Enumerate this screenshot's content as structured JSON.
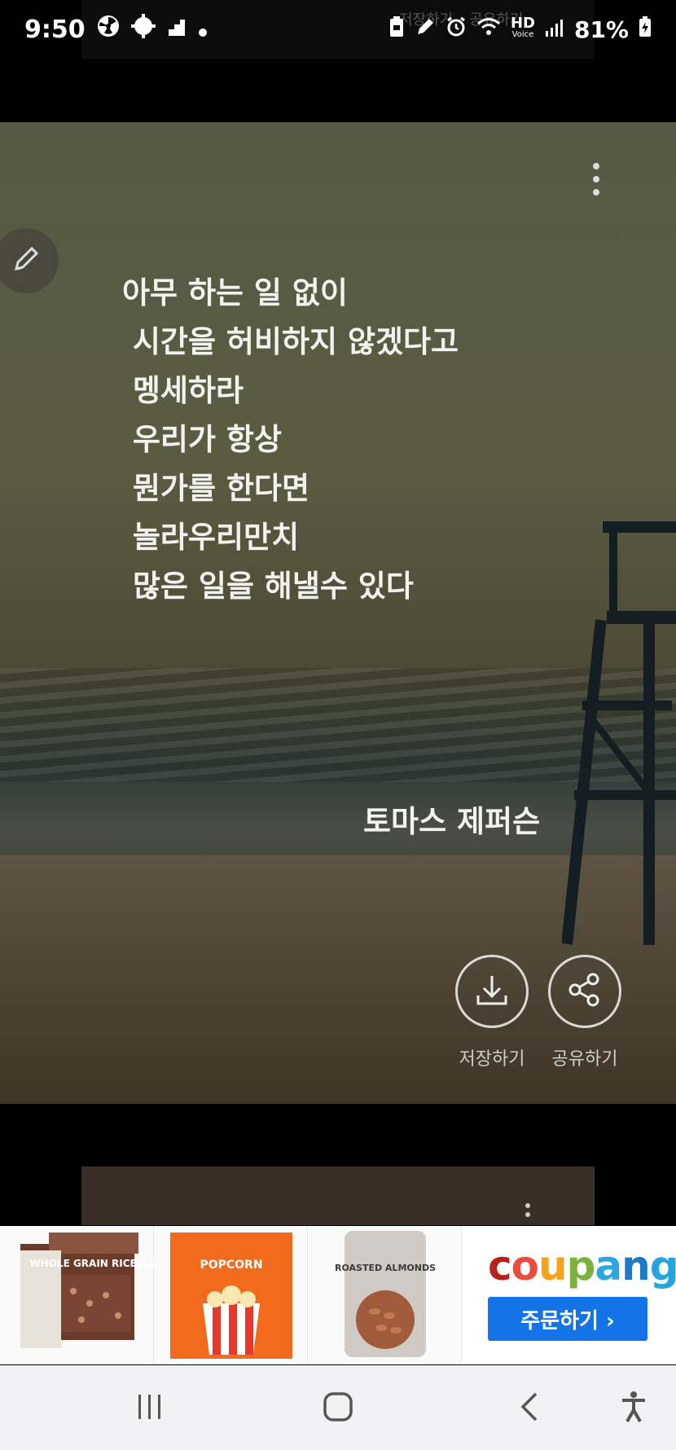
{
  "status_bar": {
    "time": "9:50",
    "battery": "81%",
    "left_icons": [
      "radiation-icon",
      "settings-gear-icon",
      "stairs-icon",
      "dot-icon"
    ],
    "right_icons": [
      "clipboard-icon",
      "pen-icon",
      "alarm-icon",
      "wifi-icon",
      "hd-voice-icon",
      "signal-icon",
      "battery-charging-icon"
    ],
    "hd_label": "HD",
    "voice_label": "Voice"
  },
  "ghost_labels": {
    "save": "저장하기",
    "share": "공유하기"
  },
  "quote_card": {
    "lines": [
      "아무 하는 일 없이",
      " 시간을 허비하지 않겠다고",
      " 멩세하라",
      " 우리가 항상",
      " 뭔가를 한다면",
      " 놀라우리만치",
      " 많은 일을 해낼수 있다"
    ],
    "author": "토마스 제퍼슨",
    "save_label": "저장하기",
    "share_label": "공유하기",
    "icons": [
      "pencil-icon",
      "more-vert-icon",
      "download-icon",
      "share-icon"
    ]
  },
  "ad": {
    "products": [
      "WHOLE GRAIN RICE BAR",
      "POPCORN",
      "ROASTED ALMONDS"
    ],
    "brand": "coupang",
    "cta": "주문하기 ›",
    "brand_colors": [
      "#c0392b",
      "#e94d3c",
      "#f7a21b",
      "#7bb13f",
      "#2aa7df",
      "#1f78c8",
      "#27a4dd"
    ]
  },
  "nav": {
    "icons": [
      "recent-apps-icon",
      "home-icon",
      "back-icon",
      "accessibility-icon"
    ]
  }
}
